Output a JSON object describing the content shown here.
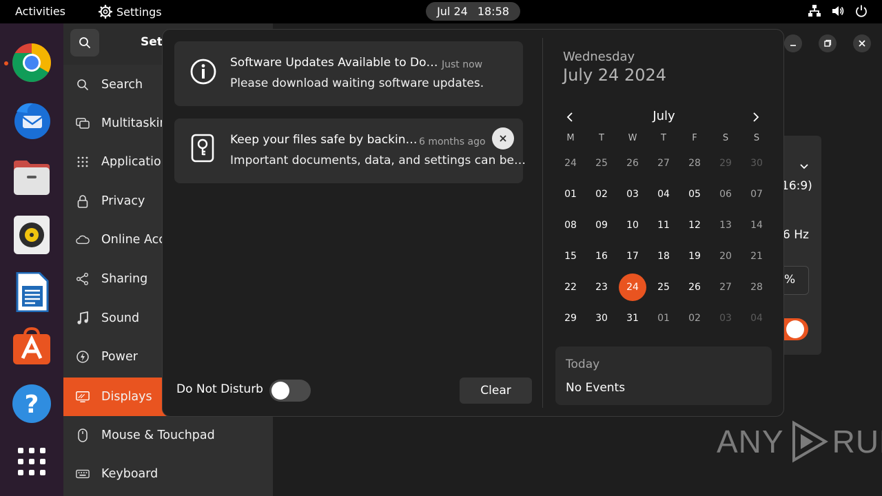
{
  "topbar": {
    "activities": "Activities",
    "app_name": "Settings",
    "date": "Jul 24",
    "time": "18:58"
  },
  "dock": {
    "apps": [
      "chrome-icon",
      "thunderbird-icon",
      "files-icon",
      "rhythmbox-icon",
      "writer-icon",
      "app-center-icon",
      "help-icon",
      "show-apps-icon"
    ]
  },
  "settings": {
    "title": "Set",
    "sidebar": [
      {
        "label": "Search",
        "icon": "search-icon"
      },
      {
        "label": "Multitaskin",
        "icon": "multitasking-icon"
      },
      {
        "label": "Applicatio",
        "icon": "apps-grid-icon"
      },
      {
        "label": "Privacy",
        "icon": "lock-icon"
      },
      {
        "label": "Online Acc",
        "icon": "cloud-icon"
      },
      {
        "label": "Sharing",
        "icon": "share-icon"
      },
      {
        "label": "Sound",
        "icon": "music-note-icon"
      },
      {
        "label": "Power",
        "icon": "power-icon"
      },
      {
        "label": "Displays",
        "icon": "display-icon",
        "active": true
      },
      {
        "label": "Mouse & Touchpad",
        "icon": "mouse-icon"
      },
      {
        "label": "Keyboard",
        "icon": "keyboard-icon"
      }
    ],
    "rows": {
      "aspect": "16:9)",
      "refresh": "6 Hz",
      "scale": "%"
    }
  },
  "popover": {
    "notifications": [
      {
        "title": "Software Updates Available to Do…",
        "time": "Just now",
        "body": "Please download waiting software updates.",
        "icon": "info-icon"
      },
      {
        "title": "Keep your files safe by backin…",
        "time": "6 months ago",
        "body": "Important documents, data, and settings can be…",
        "icon": "backup-icon"
      }
    ],
    "dnd_label": "Do Not Disturb",
    "clear_label": "Clear",
    "calendar": {
      "weekday": "Wednesday",
      "full_date": "July 24 2024",
      "month": "July",
      "dow": [
        "M",
        "T",
        "W",
        "T",
        "F",
        "S",
        "S"
      ],
      "weeks": [
        [
          "24",
          "25",
          "26",
          "27",
          "28",
          "29",
          "30"
        ],
        [
          "01",
          "02",
          "03",
          "04",
          "05",
          "06",
          "07"
        ],
        [
          "08",
          "09",
          "10",
          "11",
          "12",
          "13",
          "14"
        ],
        [
          "15",
          "16",
          "17",
          "18",
          "19",
          "20",
          "21"
        ],
        [
          "22",
          "23",
          "24",
          "25",
          "26",
          "27",
          "28"
        ],
        [
          "29",
          "30",
          "31",
          "01",
          "02",
          "03",
          "04"
        ]
      ],
      "today": "24",
      "events_heading": "Today",
      "events_text": "No Events"
    }
  },
  "watermark": {
    "left": "ANY",
    "right": "RUN"
  },
  "colors": {
    "accent": "#e95420",
    "dock_bg": "#2b1c2e"
  }
}
